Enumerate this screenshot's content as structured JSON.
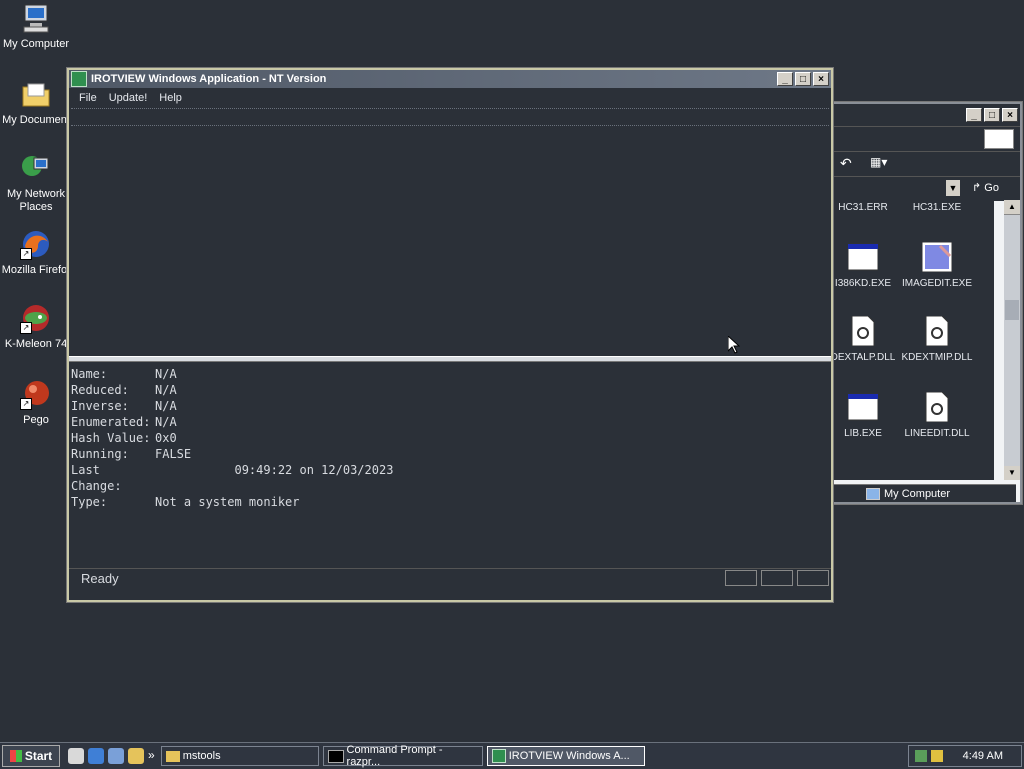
{
  "desktop": {
    "icons": [
      {
        "label": "My Computer"
      },
      {
        "label": "My Document"
      },
      {
        "label": "My Network Places"
      },
      {
        "label": "Mozilla Firefo:"
      },
      {
        "label": "K-Meleon 74"
      },
      {
        "label": "Pego"
      }
    ]
  },
  "explorer": {
    "go_label": "Go",
    "status_location": "My Computer",
    "files": [
      {
        "name": "HC31.ERR"
      },
      {
        "name": "HC31.EXE"
      },
      {
        "name": "I386KD.EXE"
      },
      {
        "name": "IMAGEDIT.EXE"
      },
      {
        "name": "DEXTALP.DLL"
      },
      {
        "name": "KDEXTMIP.DLL"
      },
      {
        "name": "LIB.EXE"
      },
      {
        "name": "LINEEDIT.DLL"
      }
    ]
  },
  "main_window": {
    "title": "IROTVIEW Windows Application - NT Version",
    "menu": [
      "File",
      "Update!",
      "Help"
    ],
    "properties": [
      {
        "key": "Name:",
        "value": "N/A"
      },
      {
        "key": "Reduced:",
        "value": "N/A"
      },
      {
        "key": "Inverse:",
        "value": "N/A"
      },
      {
        "key": "Enumerated:",
        "value": "N/A"
      },
      {
        "key": "Hash Value:",
        "value": "0x0"
      },
      {
        "key": "Running:",
        "value": "FALSE"
      },
      {
        "key": "Last Change:",
        "value": "           09:49:22 on 12/03/2023"
      },
      {
        "key": "Type:",
        "value": "Not a system moniker"
      }
    ],
    "status": "Ready"
  },
  "taskbar": {
    "start_label": "Start",
    "tasks": [
      {
        "label": "mstools"
      },
      {
        "label": "Command Prompt - razpr..."
      },
      {
        "label": "IROTVIEW Windows A..."
      }
    ],
    "clock": "4:49 AM"
  },
  "colors": {
    "desktop": "#2b3038",
    "window_border": "#c9c8a6",
    "title_gradient": "#4f5866"
  }
}
